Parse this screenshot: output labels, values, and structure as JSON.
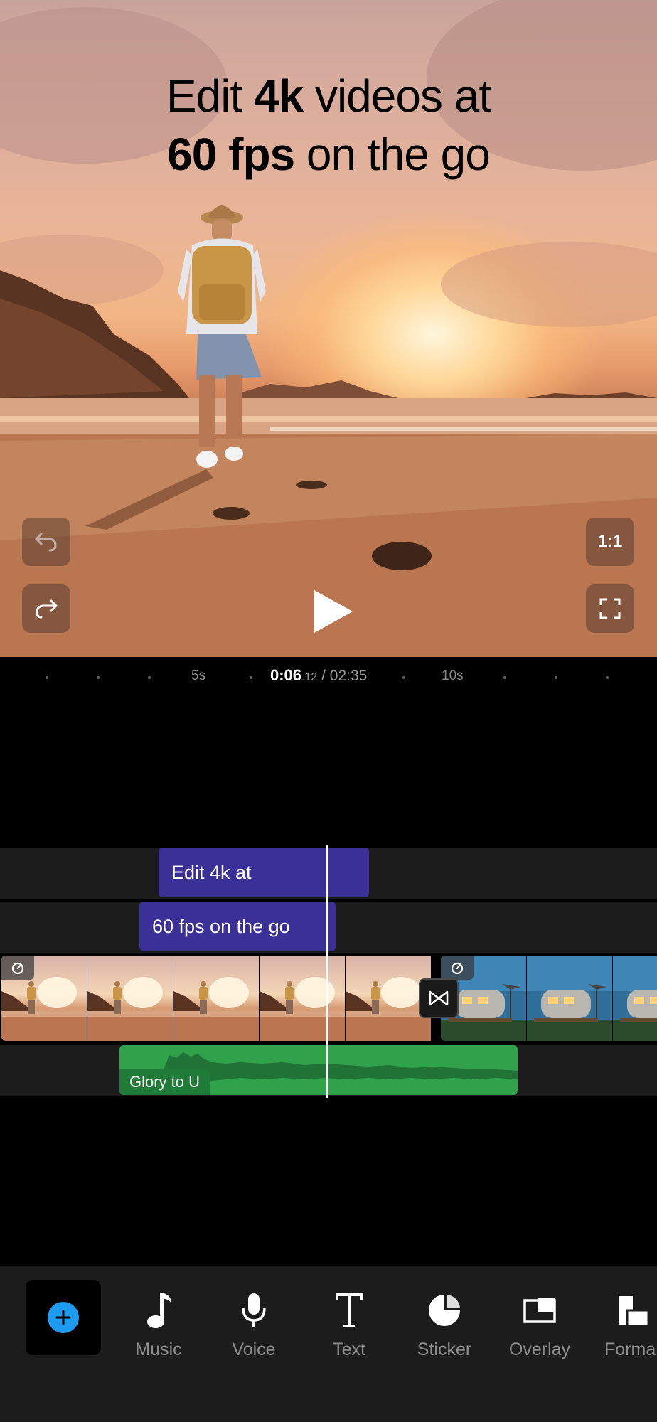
{
  "headline": {
    "line1_pre": "Edit ",
    "line1_bold": "4k",
    "line1_post": " videos at",
    "line2_bold": "60 fps",
    "line2_post": " on the go"
  },
  "preview_controls": {
    "aspect_label": "1:1"
  },
  "ruler": {
    "tick_5s": "5s",
    "tick_10s": "10s",
    "current": "0:06",
    "current_frac": ".12",
    "total": " / 02:35"
  },
  "timeline": {
    "text_clip_1": "Edit 4k at",
    "text_clip_2": "60 fps on the go",
    "audio_clip": "Glory to U"
  },
  "toolbar": {
    "items": [
      {
        "label": "Music",
        "icon": "music-note-icon"
      },
      {
        "label": "Voice",
        "icon": "microphone-icon"
      },
      {
        "label": "Text",
        "icon": "text-icon"
      },
      {
        "label": "Sticker",
        "icon": "sticker-icon"
      },
      {
        "label": "Overlay",
        "icon": "overlay-icon"
      },
      {
        "label": "Forma",
        "icon": "format-icon"
      }
    ]
  },
  "colors": {
    "accent_blue": "#1d9bf0",
    "text_clip": "#3b2f98",
    "audio_clip": "#2fa24b"
  }
}
